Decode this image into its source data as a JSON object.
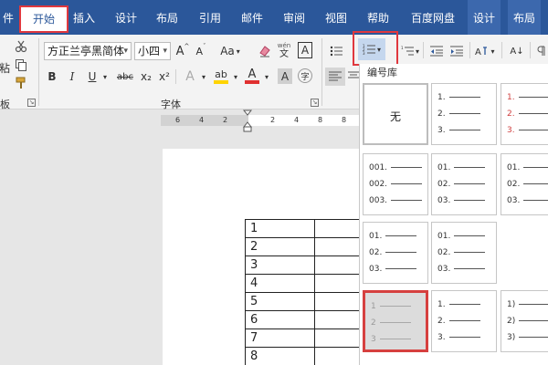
{
  "tabs": [
    "件",
    "开始",
    "插入",
    "设计",
    "布局",
    "引用",
    "邮件",
    "审阅",
    "视图",
    "帮助",
    "百度网盘",
    "设计",
    "布局"
  ],
  "ribbon": {
    "paste_label": "粘",
    "clipboard_label": "板",
    "font_name": "方正兰亭黑简体",
    "font_size": "小四",
    "font_group_label": "字体",
    "pinyin_char": "文",
    "pinyin_top": "wén",
    "bold": "B",
    "italic": "I",
    "underline": "U",
    "strike": "abc",
    "subscript": "x₂",
    "superscript": "x²",
    "grow": "A",
    "shrink": "A",
    "case": "Aa",
    "boxchar": "A",
    "sort": "A↓",
    "font_color": "A",
    "highlight": "ab",
    "shade": "A",
    "circle_char": "字"
  },
  "ruler_ticks": [
    "6",
    "4",
    "2",
    "2",
    "4",
    "8",
    "8"
  ],
  "table_rows": [
    "1",
    "2",
    "3",
    "4",
    "5",
    "6",
    "7",
    "8"
  ],
  "panel": {
    "title": "编号库",
    "none_label": "无",
    "cells": [
      [
        "1.",
        "2.",
        "3."
      ],
      [
        "1.",
        "2.",
        "3."
      ],
      [
        "001.",
        "002.",
        "003."
      ],
      [
        "01.",
        "02.",
        "03."
      ],
      [
        "01.",
        "02.",
        "03."
      ],
      [
        "01.",
        "02.",
        "03."
      ],
      [
        "01.",
        "02.",
        "03."
      ],
      [
        "1",
        "2",
        "3"
      ],
      [
        "1.",
        "2.",
        "3."
      ],
      [
        "1)",
        "2)",
        "3)"
      ]
    ]
  },
  "colors": {
    "ribbon_blue": "#2b579a",
    "highlight_red": "#e0383e",
    "font_red": "#e03030",
    "highlighter_yellow": "#ffd400"
  }
}
